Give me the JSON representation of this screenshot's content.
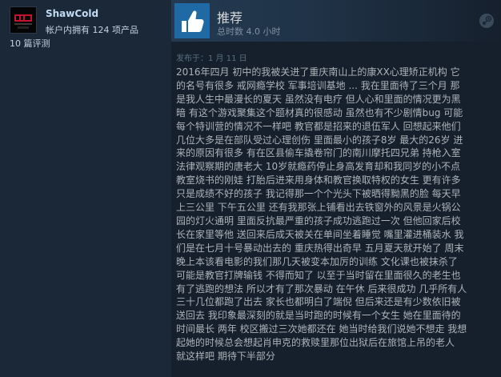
{
  "author": {
    "name": "ShawCold",
    "products_text": "帐户内拥有 124 项产品",
    "reviews_text": "10 篇评测"
  },
  "review": {
    "verdict": "推荐",
    "hours_text": "总时数 4.0 小时",
    "posted_text": "发布于：1 月 11 日",
    "body": "2016年四月 初中的我被关进了重庆南山上的康XX心理矫正机构 它\n的名号有很多 戒网瘾学校 军事培训基地 ... 我在里面待了三个月 那\n是我人生中最漫长的夏天 虽然没有电疗 但人心和里面的情况更为黑\n暗 有这个游戏聚集这个题材真的很感动 虽然也有不少剧情bug 可能\n每个特训营的情况不一样吧 教官都是招来的退伍军人 回想起来他们\n几位大多是在部队受过心理创伤 里面最小的孩子8岁 最大的26岁 进\n来的原因有很多 有在区县偷车撬卷帘门的南川摩托四兄弟 持枪入室\n法律观察期的唐老大 10岁就瘾药停止身高发育却和我同岁的小不点\n教室烧书的刚娃 打胎后进来用身体和教官换取特权的女生 更有许多\n只是成绩不好的孩子 我记得那一个个光头下被晒得黝黑的脸 每天早\n上三公里 下午五公里 还有我那张上铺看出去铁窗外的风景是火锅公\n园的灯火通明 里面反抗最严重的孩子成功逃跑过一次 但他回家后校\n长在家里等他 送回来后成天被关在单间坐着睡觉 嘴里灌进桶装水 我\n们是在七月十号暴动出去的 重庆热得出奇早 五月夏天就开始了 周末\n晚上本该看电影的我们那几天被变本加厉的训练 文化课也被抹杀了\n可能是教官打牌输钱 不得而知了 以至于当时留在里面很久的老生也\n有了逃跑的想法 所以才有了那次暴动 在午休 后来很成功 几乎所有人\n三十几位都跑了出去 家长也都明白了端倪 但后来还是有少数依旧被\n送回去 我印象最深刻的就是当时跑的时候有一个女生 她在里面待的\n时间最长 两年 校区搬过三次她都还在 她当时给我们说她不想走 我想\n起她的时候总会想起肖申克的救赎里那位出狱后在旅馆上吊的老人\n就这样吧 期待下半部分"
  },
  "icons": {
    "avatar": "avatar-image",
    "thumb": "thumbs-up-icon",
    "platform": "steam-logo-icon"
  },
  "colors": {
    "background": "#1b2838",
    "author_name": "#c1dbf4",
    "verdict_thumb_bg": "#1f6aa5",
    "body_text": "#acb2b8"
  }
}
